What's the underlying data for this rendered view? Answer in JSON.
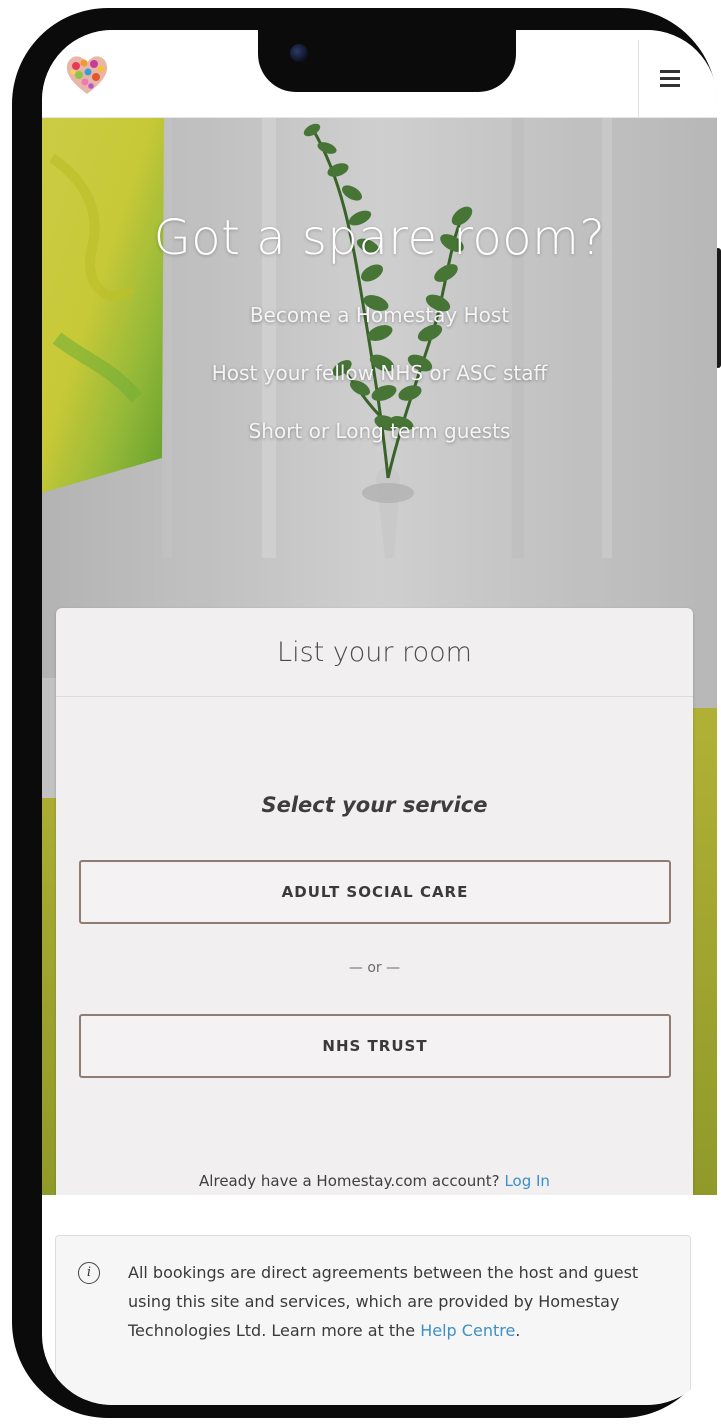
{
  "header": {
    "logo_alt": "Homestay logo",
    "menu_icon": "hamburger-menu-icon"
  },
  "hero": {
    "title": "Got a spare room?",
    "line1": "Become a Homestay Host",
    "line2": "Host your fellow NHS or ASC staff",
    "line3": "Short or Long term guests"
  },
  "card": {
    "title": "List your room",
    "subtitle": "Select your service",
    "option1": "ADULT SOCIAL CARE",
    "separator": "— or —",
    "option2": "NHS TRUST",
    "login_prompt": "Already have a Homestay.com account?",
    "login_link": "Log In"
  },
  "info": {
    "icon": "info-icon",
    "text": "All bookings are direct agreements between the host and guest using this site and services, which are provided by Homestay Technologies Ltd. Learn more at the",
    "link": "Help Centre",
    "suffix": "."
  },
  "colors": {
    "link": "#3d8fc6",
    "button_border": "#8f7d75",
    "card_background": "#f1efef"
  }
}
